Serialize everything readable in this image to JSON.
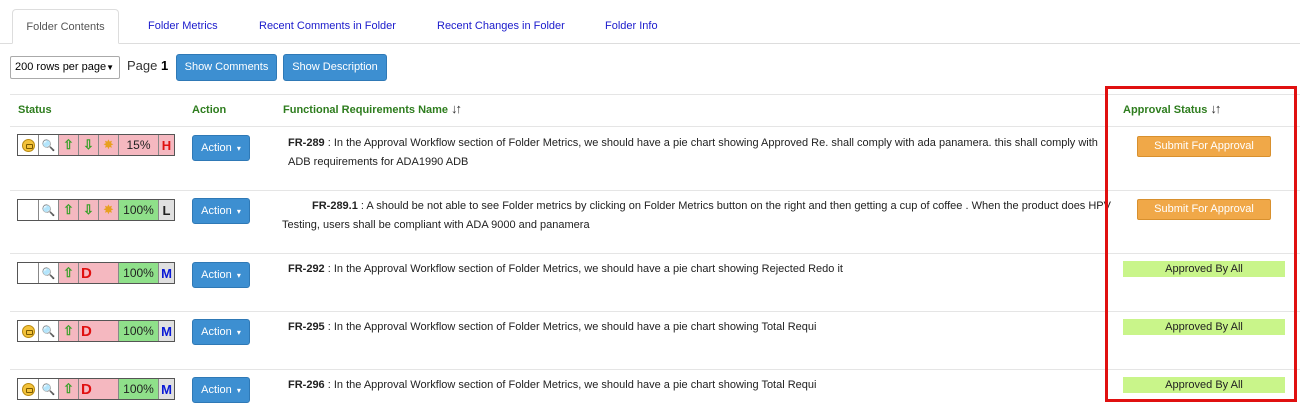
{
  "tabs": [
    {
      "label": "Folder Contents",
      "active": true
    },
    {
      "label": "Folder Metrics"
    },
    {
      "label": "Recent Comments in Folder"
    },
    {
      "label": "Recent Changes in Folder"
    },
    {
      "label": "Folder Info"
    }
  ],
  "toolbar": {
    "rows_per_page": "200 rows per page",
    "page_label": "Page",
    "page_number": "1",
    "show_comments": "Show Comments",
    "show_description": "Show Description"
  },
  "headers": {
    "status": "Status",
    "action": "Action",
    "name": "Functional Requirements Name",
    "approval": "Approval Status"
  },
  "rows": [
    {
      "percent": "15%",
      "priority": "H",
      "action": "Action",
      "id": "FR-289",
      "text": " : In the Approval Workflow section of Folder Metrics, we should have a pie chart showing Approved Re. shall comply with ada panamera. this shall comply with ADB requirements for ADA1990 ADB",
      "approval": "Submit For Approval"
    },
    {
      "percent": "100%",
      "priority": "L",
      "action": "Action",
      "id": "FR-289.1",
      "text": " : A should be not able to see Folder metrics by clicking on Folder Metrics button on the right and then getting a cup of coffee . When the product does HPV Testing, users shall be compliant with ADA 9000 and panamera",
      "approval": "Submit For Approval"
    },
    {
      "d": "D",
      "percent": "100%",
      "priority": "M",
      "action": "Action",
      "id": "FR-292",
      "text": " : In the Approval Workflow section of Folder Metrics, we should have a pie chart showing Rejected Redo it",
      "approval": "Approved By All"
    },
    {
      "d": "D",
      "percent": "100%",
      "priority": "M",
      "action": "Action",
      "id": "FR-295",
      "text": " : In the Approval Workflow section of Folder Metrics, we should have a pie chart showing Total Requi",
      "approval": "Approved By All"
    },
    {
      "d": "D",
      "percent": "100%",
      "priority": "M",
      "action": "Action",
      "id": "FR-296",
      "text": " : In the Approval Workflow section of Folder Metrics, we should have a pie chart showing Total Requi",
      "approval": "Approved By All"
    }
  ],
  "colors": {
    "accent_button": "#3d8fd1",
    "submit_button": "#f0a848",
    "approved_badge": "#c9f58a",
    "header_text": "#2e7d1e",
    "highlight": "#e01010"
  },
  "icons": [
    "lock-icon",
    "search-icon",
    "arrow-up-icon",
    "arrow-down-icon",
    "star-icon",
    "sort-icon",
    "caret-down-icon"
  ]
}
